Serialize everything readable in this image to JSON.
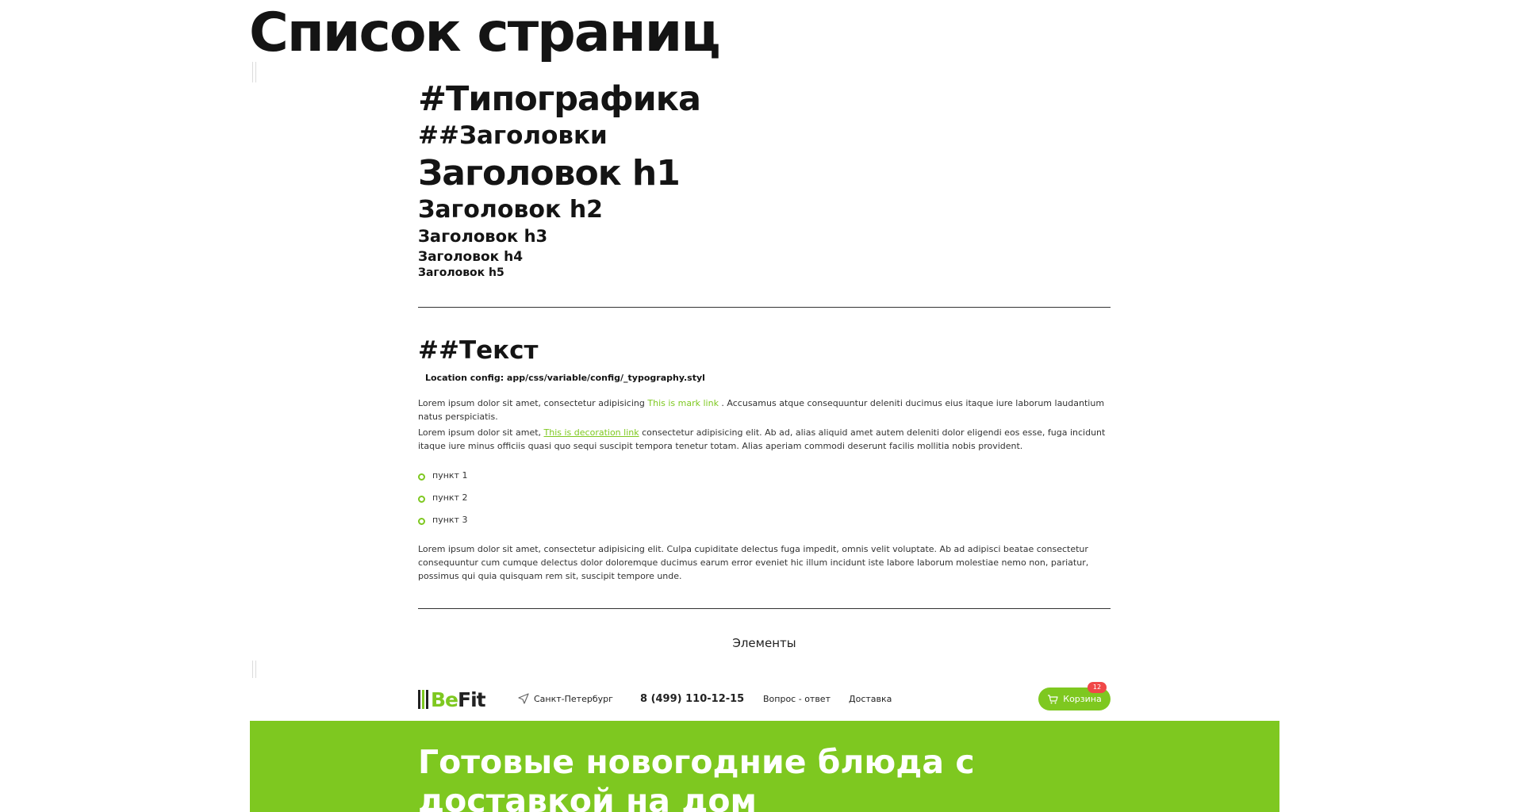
{
  "page_title": "Список страниц",
  "typography": {
    "title": "#Типографика",
    "headings_title": "##Заголовки",
    "h1": "Заголовок h1",
    "h2": "Заголовок h2",
    "h3": "Заголовок h3",
    "h4": "Заголовок h4",
    "h5": "Заголовок h5"
  },
  "text_section": {
    "title": "##Текст",
    "config": "Location config: app/css/variable/config/_typography.styl",
    "para1_before": "Lorem ipsum dolor sit amet, consectetur adipisicing ",
    "para1_link": "This is mark link",
    "para1_after": " . Accusamus atque consequuntur deleniti ducimus eius itaque iure laborum laudantium natus perspiciatis.",
    "para2_before": "Lorem ipsum dolor sit amet, ",
    "para2_link": "This is decoration link",
    "para2_after": " consectetur adipisicing elit. Ab ad, alias aliquid amet autem deleniti dolor eligendi eos esse, fuga incidunt itaque iure minus officiis quasi quo sequi suscipit tempora tenetur totam. Alias aperiam commodi deserunt facilis mollitia nobis provident.",
    "list_items": [
      "пункт 1",
      "пункт 2",
      "пункт 3"
    ],
    "para3": "Lorem ipsum dolor sit amet, consectetur adipisicing elit. Culpa cupiditate delectus fuga impedit, omnis velit voluptate. Ab ad adipisci beatae consectetur consequuntur cum cumque delectus dolor doloremque ducimus earum error eveniet hic illum incidunt iste labore laborum molestiae nemo non, pariatur, possimus qui quia quisquam rem sit, suscipit tempore unde."
  },
  "elements_caption": "Элементы",
  "site_header": {
    "logo_be": "Be",
    "logo_fit": "Fit",
    "city": "Санкт-Петербург",
    "phone": "8 (499) 110-12-15",
    "nav_faq": "Вопрос - ответ",
    "nav_delivery": "Доставка",
    "cart_label": "Корзина",
    "cart_count": "12"
  },
  "hero": {
    "title": "Готовые новогодние блюда с доставкой на дом"
  },
  "colors": {
    "accent": "#7ec820",
    "text": "#141414",
    "badge": "#f04848"
  }
}
